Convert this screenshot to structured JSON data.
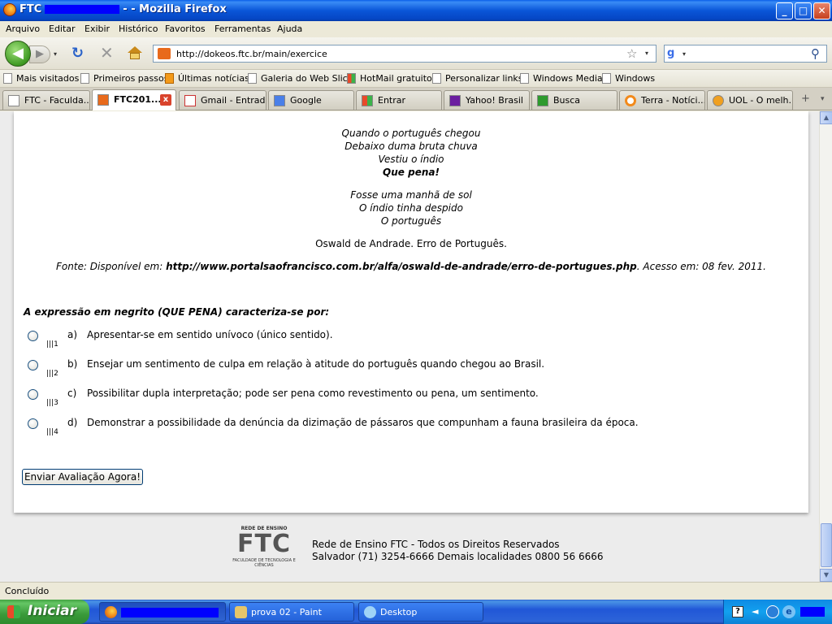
{
  "window": {
    "title_prefix": "FTC",
    "title_suffix": "- - Mozilla Firefox",
    "min": "_",
    "max": "□",
    "close": "✕"
  },
  "menu": [
    "Arquivo",
    "Editar",
    "Exibir",
    "Histórico",
    "Favoritos",
    "Ferramentas",
    "Ajuda"
  ],
  "nav": {
    "back": "◀",
    "forward": "▶",
    "dropdown": "▾",
    "reload": "↻",
    "stop": "✕",
    "url": "http://dokeos.ftc.br/main/exercice",
    "bookmark_star": "☆",
    "url_arrow": "▾",
    "search_engine": "g",
    "search_arrow": "▾",
    "search_placeholder": "",
    "search_icon": "⚲"
  },
  "bookmarks": [
    "Mais visitados",
    "Primeiros passos",
    "Últimas notícias",
    "Galeria do Web Slice",
    "HotMail gratuito",
    "Personalizar links",
    "Windows Media",
    "Windows"
  ],
  "tabs": [
    {
      "label": "FTC - Faculda...",
      "active": false
    },
    {
      "label": "FTC201...",
      "active": true
    },
    {
      "label": "Gmail - Entrad...",
      "active": false
    },
    {
      "label": "Google",
      "active": false
    },
    {
      "label": "Entrar",
      "active": false
    },
    {
      "label": "Yahoo! Brasil",
      "active": false
    },
    {
      "label": "Busca",
      "active": false
    },
    {
      "label": "Terra - Notíci...",
      "active": false
    },
    {
      "label": "UOL - O melh...",
      "active": false
    }
  ],
  "tab_controls": {
    "new_tab": "+",
    "list": "▾",
    "close": "x"
  },
  "poem": {
    "stanza1": [
      "Quando o português chegou",
      "Debaixo duma bruta chuva",
      "Vestiu o índio"
    ],
    "stanza1_bold": "Que pena!",
    "stanza2": [
      "Fosse uma manhã de sol",
      "O índio tinha despido",
      "O português"
    ],
    "author": "Oswald de Andrade. Erro de Português.",
    "source_prefix": "Fonte: Disponível em: ",
    "source_url": "http://www.portalsaofrancisco.com.br/alfa/oswald-de-andrade/erro-de-portugues.php",
    "source_suffix": ". Acesso em: 08 fev. 2011."
  },
  "question": "A expressão em negrito (QUE PENA) caracteriza-se por:",
  "options": [
    {
      "letter": "a)",
      "num": "|||1",
      "text": "Apresentar-se em sentido unívoco (único sentido)."
    },
    {
      "letter": "b)",
      "num": "|||2",
      "text": "Ensejar um sentimento de culpa em relação à atitude do português quando chegou ao Brasil."
    },
    {
      "letter": "c)",
      "num": "|||3",
      "text": "Possibilitar dupla interpretação; pode ser pena como revestimento ou pena, um sentimento."
    },
    {
      "letter": "d)",
      "num": "|||4",
      "text": "Demonstrar a possibilidade da denúncia da dizimação de pássaros que compunham a fauna brasileira da época."
    }
  ],
  "submit_label": "Enviar Avaliação Agora!",
  "footer": {
    "logo_top": "REDE DE ENSINO",
    "logo_main": "FTC",
    "logo_bottom": "FACULDADE DE TECNOLOGIA E CIÊNCIAS",
    "line1": "Rede de Ensino FTC - Todos os Direitos Reservados",
    "line2": "Salvador (71) 3254-6666 Demais localidades 0800 56 6666"
  },
  "scrollbar": {
    "up": "▲",
    "down": "▼"
  },
  "status": "Concluído",
  "taskbar": {
    "start": "Iniciar",
    "tasks": [
      "prova 02 - Paint",
      "Desktop"
    ],
    "help": "?",
    "volume": "◄",
    "ie": "e"
  }
}
